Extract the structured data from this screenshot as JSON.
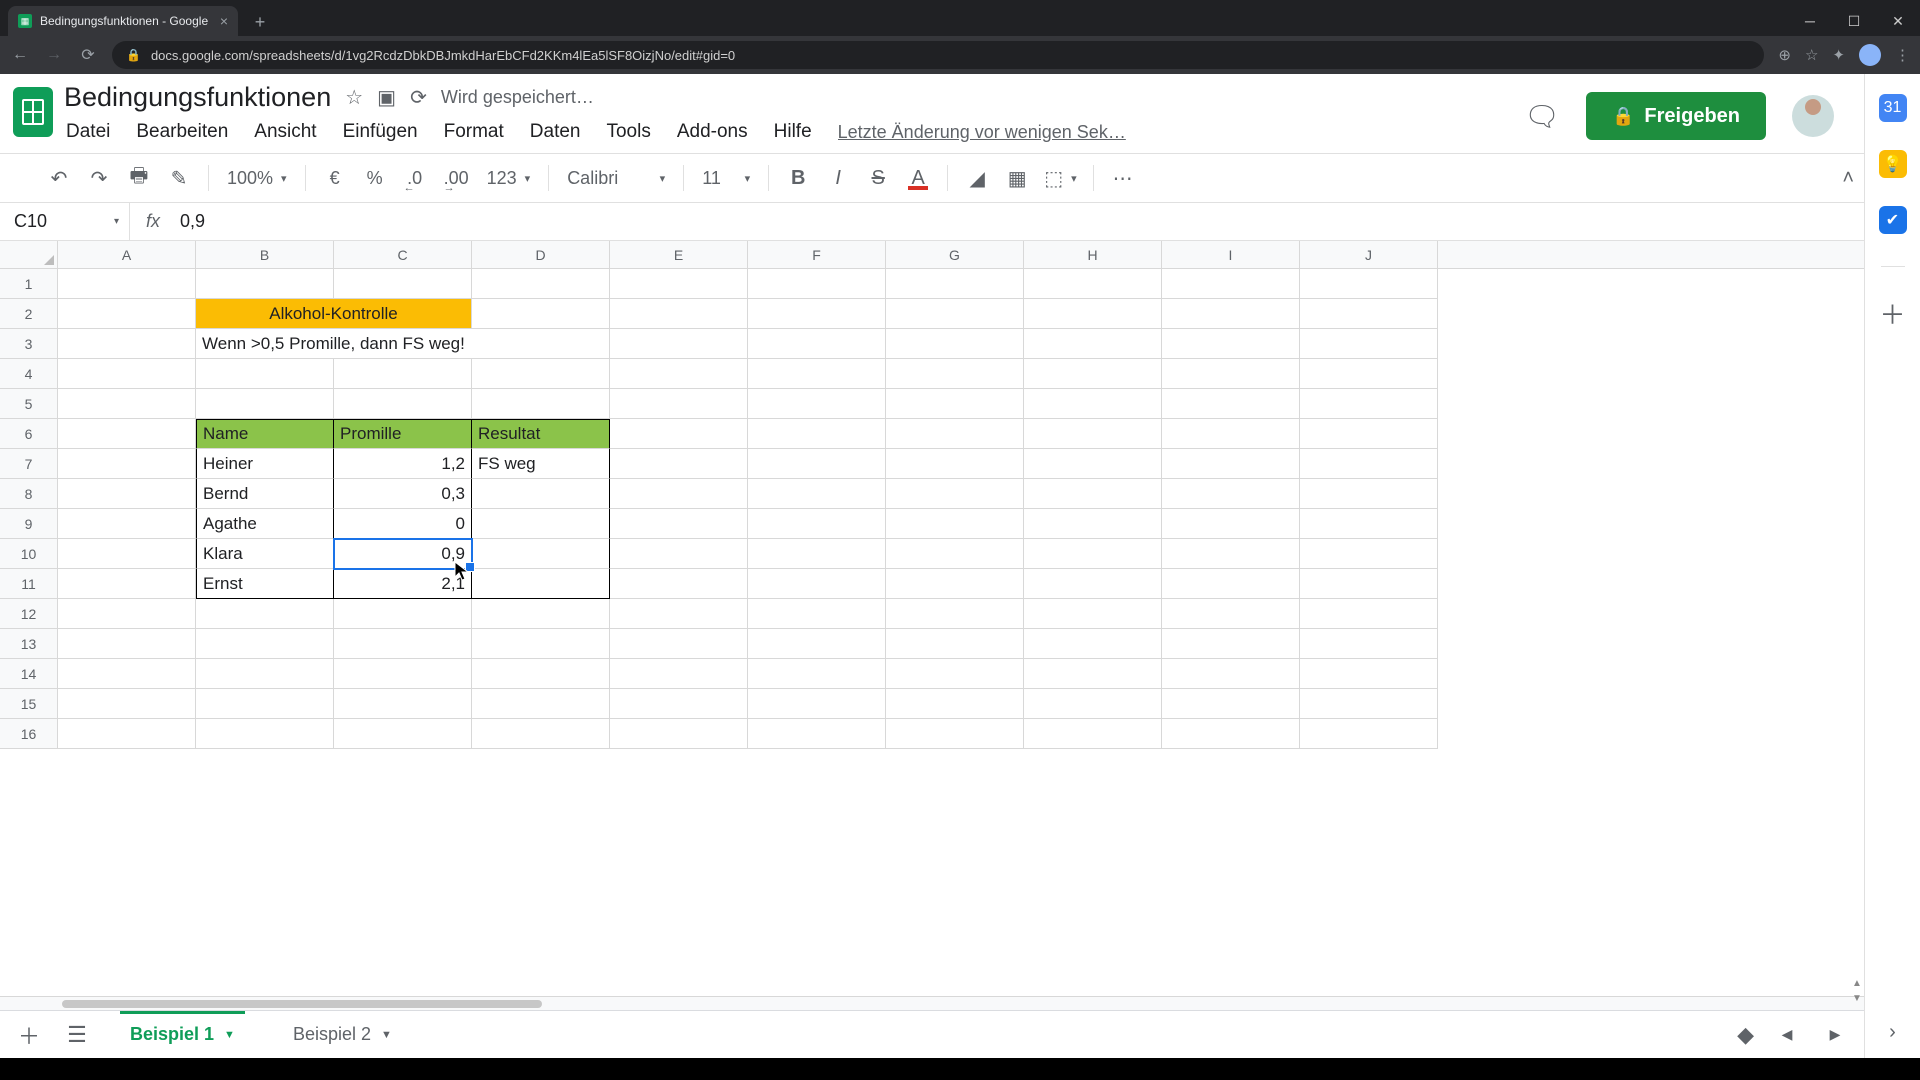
{
  "browser": {
    "tab_title": "Bedingungsfunktionen - Google",
    "url": "docs.google.com/spreadsheets/d/1vg2RcdzDbkDBJmkdHarEbCFd2KKm4lEa5lSF8OizjNo/edit#gid=0"
  },
  "header": {
    "doc_title": "Bedingungsfunktionen",
    "saving": "Wird gespeichert…",
    "last_edit": "Letzte Änderung vor wenigen Sek…",
    "share_label": "Freigeben"
  },
  "menus": {
    "file": "Datei",
    "edit": "Bearbeiten",
    "view": "Ansicht",
    "insert": "Einfügen",
    "format": "Format",
    "data": "Daten",
    "tools": "Tools",
    "addons": "Add-ons",
    "help": "Hilfe"
  },
  "toolbar": {
    "zoom": "100%",
    "currency": "€",
    "percent": "%",
    "dec_less": ".0",
    "dec_more": ".00",
    "num_format": "123",
    "font": "Calibri",
    "font_size": "11",
    "bold": "B",
    "italic": "I",
    "strike": "S",
    "text_color": "A"
  },
  "namebox": "C10",
  "formula": "0,9",
  "columns": [
    "A",
    "B",
    "C",
    "D",
    "E",
    "F",
    "G",
    "H",
    "I",
    "J"
  ],
  "rows": [
    "1",
    "2",
    "3",
    "4",
    "5",
    "6",
    "7",
    "8",
    "9",
    "10",
    "11",
    "12",
    "13",
    "14",
    "15",
    "16"
  ],
  "sheets": {
    "tab1": "Beispiel 1",
    "tab2": "Beispiel 2"
  },
  "chart_data": {
    "type": "table",
    "title": "Alkohol-Kontrolle",
    "subtitle": "Wenn >0,5 Promille, dann FS weg!",
    "headers": {
      "name": "Name",
      "promille": "Promille",
      "resultat": "Resultat"
    },
    "rows": [
      {
        "name": "Heiner",
        "promille": "1,2",
        "resultat": "FS weg"
      },
      {
        "name": "Bernd",
        "promille": "0,3",
        "resultat": ""
      },
      {
        "name": "Agathe",
        "promille": "0",
        "resultat": ""
      },
      {
        "name": "Klara",
        "promille": "0,9",
        "resultat": ""
      },
      {
        "name": "Ernst",
        "promille": "2,1",
        "resultat": ""
      }
    ]
  }
}
